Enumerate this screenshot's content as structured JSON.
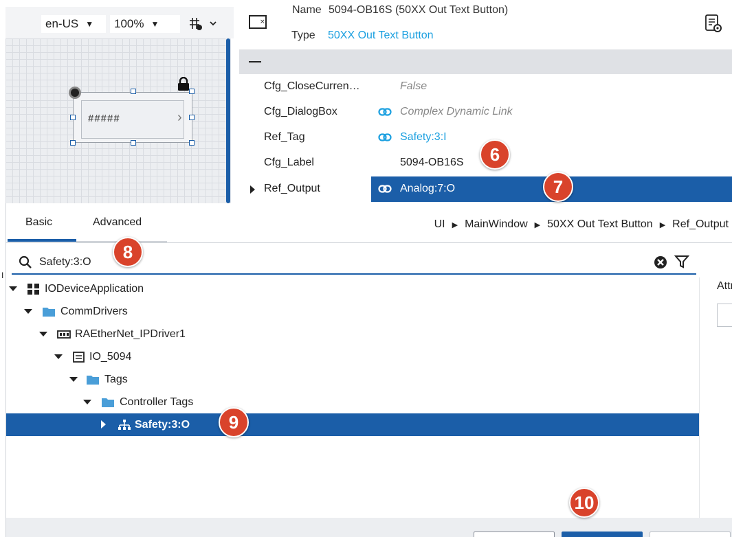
{
  "toolbar": {
    "language": "en-US",
    "zoom": "100%"
  },
  "canvas": {
    "widget_text": "#####"
  },
  "properties": {
    "name_label": "Name",
    "name_value": "5094-OB16S (50XX Out Text Button)",
    "type_label": "Type",
    "type_value": "50XX Out Text Button",
    "rows": [
      {
        "key": "Cfg_CloseCurren…",
        "value": "False"
      },
      {
        "key": "Cfg_DialogBox",
        "value": "Complex Dynamic Link"
      },
      {
        "key": "Ref_Tag",
        "value": "Safety:3:I"
      },
      {
        "key": "Cfg_Label",
        "value": "5094-OB16S"
      },
      {
        "key": "Ref_Output",
        "value": "Analog:7:O"
      }
    ]
  },
  "dialog": {
    "tabs": [
      "Basic",
      "Advanced"
    ],
    "breadcrumb": [
      "UI",
      "MainWindow",
      "50XX Out Text Button",
      "Ref_Output"
    ],
    "search_value": "Safety:3:O",
    "tree": [
      {
        "label": "IODeviceApplication"
      },
      {
        "label": "CommDrivers"
      },
      {
        "label": "RAEtherNet_IPDriver1"
      },
      {
        "label": "IO_5094"
      },
      {
        "label": "Tags"
      },
      {
        "label": "Controller Tags"
      },
      {
        "label": "Safety:3:O"
      }
    ],
    "side_label": "Attr",
    "stray_char": "I"
  },
  "callouts": [
    "6",
    "7",
    "8",
    "9",
    "10"
  ],
  "colors": {
    "accent": "#1b5ea8",
    "link": "#1ca0e0",
    "callout": "#d9432b"
  }
}
